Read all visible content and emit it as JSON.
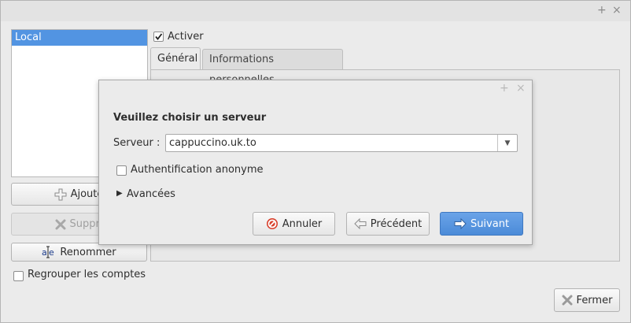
{
  "window": {
    "controls": {
      "maximize": "+",
      "close": "×"
    }
  },
  "accounts": {
    "items": [
      {
        "label": "Local",
        "selected": true
      }
    ]
  },
  "buttons": {
    "add": "Ajoute",
    "remove": "Suppri",
    "rename": "Renommer",
    "close": "Fermer"
  },
  "group_accounts": {
    "label": "Regrouper les comptes",
    "checked": false
  },
  "activate": {
    "label": "Activer",
    "checked": true
  },
  "tabs": [
    {
      "label": "Général",
      "active": true
    },
    {
      "label": "Informations personnelles",
      "active": false
    }
  ],
  "dialog": {
    "controls": {
      "maximize": "+",
      "close": "×"
    },
    "heading": "Veuillez choisir un serveur",
    "server_label": "Serveur :",
    "server_value": "cappuccino.uk.to",
    "anonymous_auth": {
      "label": "Authentification anonyme",
      "checked": false
    },
    "advanced": "Avancées",
    "buttons": {
      "cancel": "Annuler",
      "previous": "Précédent",
      "next": "Suivant"
    }
  },
  "colors": {
    "selection": "#5294e2",
    "primary_button": "#4b8bd8",
    "cancel_icon": "#d9402c"
  },
  "icons": {
    "add": "plus-icon",
    "remove": "x-icon",
    "rename": "rename-icon",
    "close": "x-icon",
    "cancel": "stop-icon",
    "previous": "arrow-left-icon",
    "next": "arrow-right-icon"
  }
}
